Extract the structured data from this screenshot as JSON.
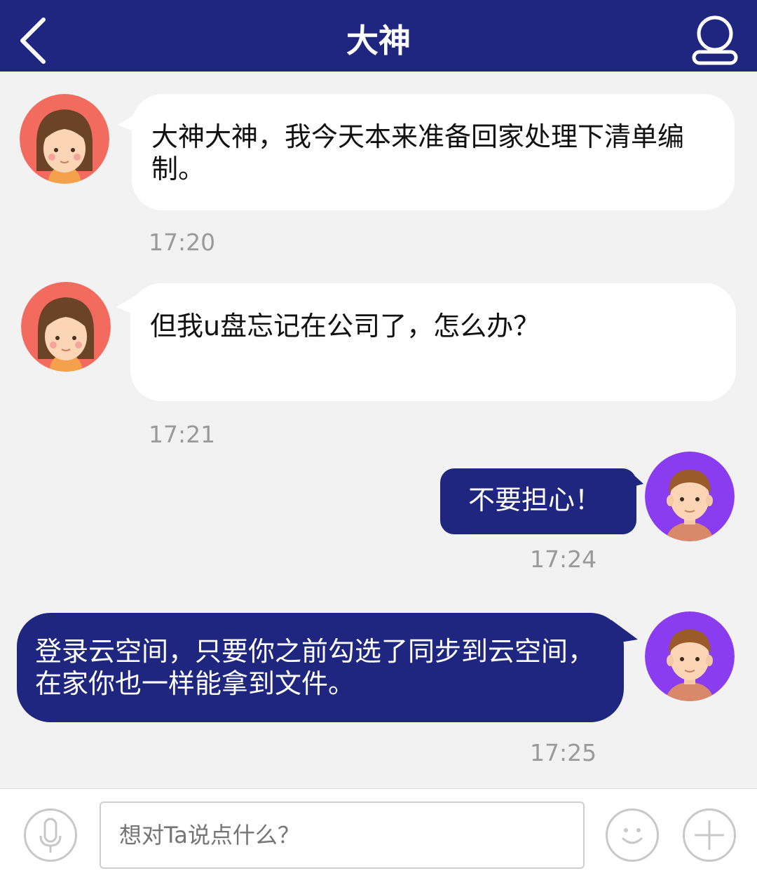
{
  "header": {
    "title": "大神"
  },
  "messages": [
    {
      "side": "received",
      "text": "大神大神，我今天本来准备回家处理下清单编制。",
      "time": "17:20"
    },
    {
      "side": "received",
      "text": "但我u盘忘记在公司了，怎么办？",
      "time": "17:21"
    },
    {
      "side": "sent",
      "text": "不要担心！",
      "time": "17:24"
    },
    {
      "side": "sent",
      "text": "登录云空间，只要你之前勾选了同步到云空间，在家你也一样能拿到文件。",
      "time": "17:25"
    }
  ],
  "composer": {
    "placeholder": "想对Ta说点什么？"
  },
  "icons": {
    "back": "chevron-left-icon",
    "profile": "user-icon",
    "voice": "microphone-icon",
    "emoji": "smiley-icon",
    "more": "plus-icon"
  },
  "colors": {
    "header_bg": "#1f2680",
    "sent_bubble": "#1f2680",
    "received_bubble": "#ffffff",
    "chat_bg": "#f2f2f2",
    "female_avatar_bg": "#f26b5e",
    "male_avatar_bg": "#8a3df0"
  }
}
